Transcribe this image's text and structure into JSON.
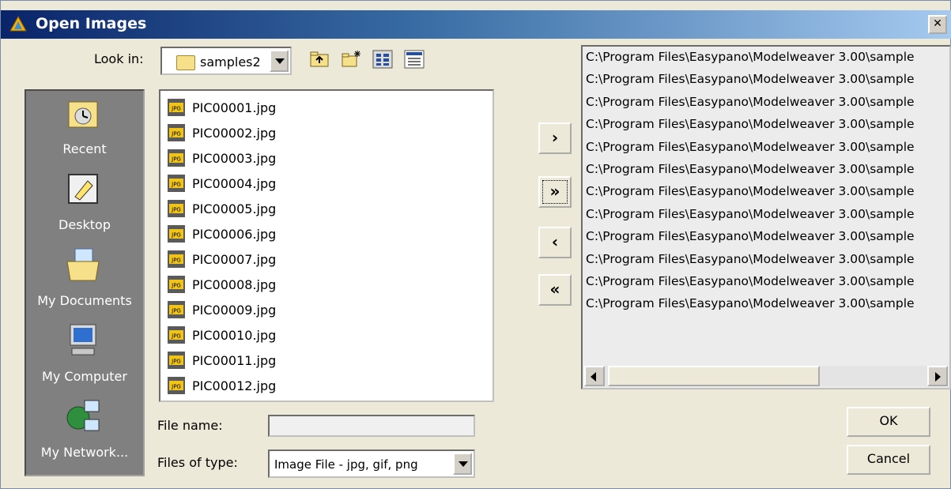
{
  "window": {
    "title": "Open Images",
    "close_glyph": "✕"
  },
  "lookin": {
    "label": "Look in:",
    "value": "samples2"
  },
  "toolbar": {
    "icons": [
      "up-folder-icon",
      "new-folder-icon",
      "list-view-icon",
      "details-view-icon"
    ]
  },
  "places": [
    {
      "label": "Recent",
      "icon": "recent-icon"
    },
    {
      "label": "Desktop",
      "icon": "desktop-icon"
    },
    {
      "label": "My Documents",
      "icon": "my-documents-icon"
    },
    {
      "label": "My Computer",
      "icon": "my-computer-icon"
    },
    {
      "label": "My Network...",
      "icon": "my-network-icon"
    }
  ],
  "files": [
    "PIC00001.jpg",
    "PIC00002.jpg",
    "PIC00003.jpg",
    "PIC00004.jpg",
    "PIC00005.jpg",
    "PIC00006.jpg",
    "PIC00007.jpg",
    "PIC00008.jpg",
    "PIC00009.jpg",
    "PIC00010.jpg",
    "PIC00011.jpg",
    "PIC00012.jpg"
  ],
  "file_icon_text": "JPG",
  "filename": {
    "label": "File name:",
    "value": ""
  },
  "filetype": {
    "label": "Files of type:",
    "value": "Image File - jpg, gif, png"
  },
  "move_buttons": {
    "add": "›",
    "add_all": "»",
    "remove": "‹",
    "remove_all": "«"
  },
  "selected_paths": [
    "C:\\Program Files\\Easypano\\Modelweaver 3.00\\sample",
    "C:\\Program Files\\Easypano\\Modelweaver 3.00\\sample",
    "C:\\Program Files\\Easypano\\Modelweaver 3.00\\sample",
    "C:\\Program Files\\Easypano\\Modelweaver 3.00\\sample",
    "C:\\Program Files\\Easypano\\Modelweaver 3.00\\sample",
    "C:\\Program Files\\Easypano\\Modelweaver 3.00\\sample",
    "C:\\Program Files\\Easypano\\Modelweaver 3.00\\sample",
    "C:\\Program Files\\Easypano\\Modelweaver 3.00\\sample",
    "C:\\Program Files\\Easypano\\Modelweaver 3.00\\sample",
    "C:\\Program Files\\Easypano\\Modelweaver 3.00\\sample",
    "C:\\Program Files\\Easypano\\Modelweaver 3.00\\sample",
    "C:\\Program Files\\Easypano\\Modelweaver 3.00\\sample"
  ],
  "buttons": {
    "ok": "OK",
    "cancel": "Cancel"
  },
  "colors": {
    "title_gradient_start": "#0a246a",
    "title_gradient_end": "#a6caf0",
    "places_bg": "#808080",
    "dialog_bg": "#ece9d8"
  }
}
